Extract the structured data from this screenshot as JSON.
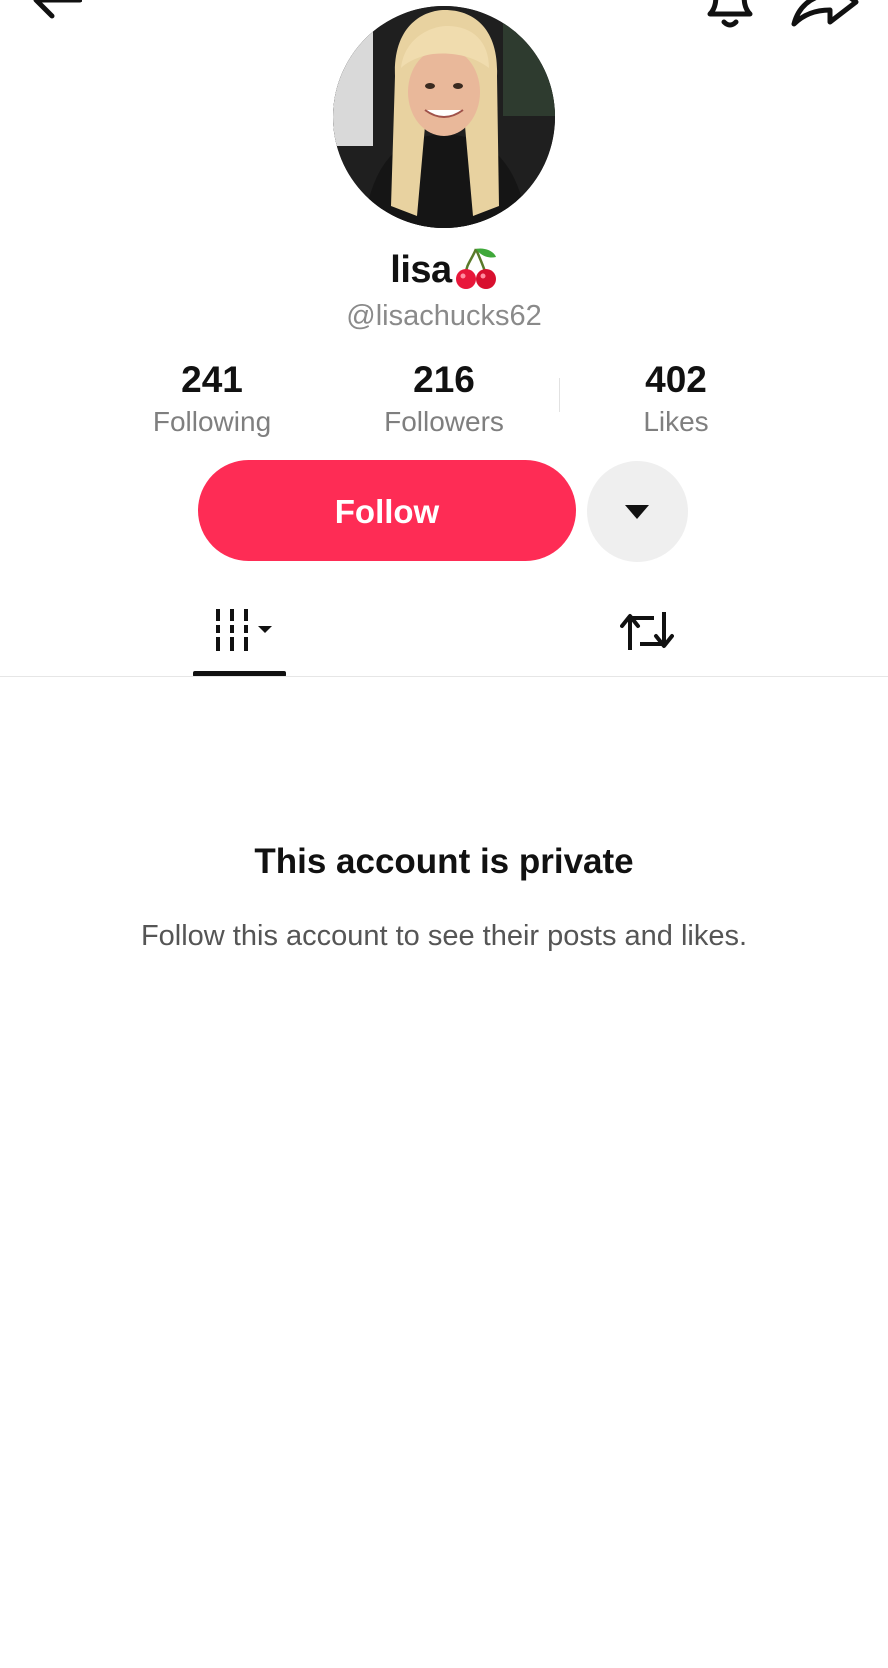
{
  "header": {
    "back_icon": "back-arrow-icon",
    "notification_icon": "bell-icon",
    "share_icon": "share-icon"
  },
  "profile": {
    "name": "lisa",
    "name_emoji": "cherry-icon",
    "handle": "@lisachucks62"
  },
  "stats": {
    "following": {
      "value": "241",
      "label": "Following"
    },
    "followers": {
      "value": "216",
      "label": "Followers"
    },
    "likes": {
      "value": "402",
      "label": "Likes"
    }
  },
  "actions": {
    "follow_label": "Follow",
    "more_icon": "caret-down-icon"
  },
  "tabs": [
    {
      "name": "videos",
      "icon": "videos-grid-icon",
      "active": true
    },
    {
      "name": "reposts",
      "icon": "repost-icon",
      "active": false
    }
  ],
  "private_notice": {
    "title": "This account is private",
    "subtitle": "Follow this account to see their posts and likes."
  },
  "colors": {
    "accent": "#fe2c55",
    "secondary_button": "#efefef",
    "muted_text": "#8a8a8a"
  }
}
